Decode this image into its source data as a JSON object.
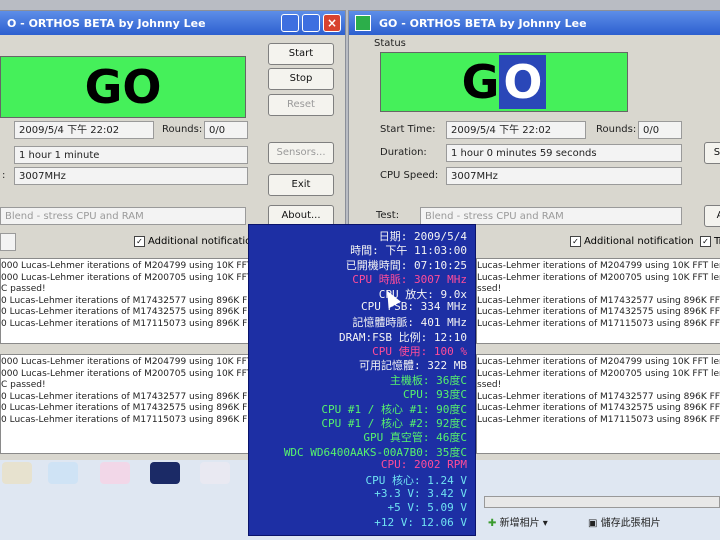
{
  "left_window": {
    "title": "O - ORTHOS BETA by Johnny Lee",
    "go_label": "GO",
    "buttons": {
      "start": "Start",
      "stop": "Stop",
      "reset": "Reset",
      "sensors": "Sensors...",
      "exit": "Exit",
      "about": "About..."
    },
    "start_time": "2009/5/4 下午 22:02",
    "rounds_label": "Rounds:",
    "rounds_value": "0/0",
    "duration": "1 hour 1 minute",
    "cpu_speed": "3007MHz",
    "test_value": "Blend - stress CPU and RAM",
    "additional_notification": "Additional notification",
    "log_top": [
      "000 Lucas-Lehmer iterations of M204799 using 10K FFT length.",
      "000 Lucas-Lehmer iterations of M200705 using 10K FFT length.",
      "C passed!",
      "0 Lucas-Lehmer iterations of M17432577 using 896K FFT length.",
      "0 Lucas-Lehmer iterations of M17432575 using 896K FFT length.",
      "0 Lucas-Lehmer iterations of M17115073 using 896K FFT length."
    ],
    "log_bottom": [
      "000 Lucas-Lehmer iterations of M204799 using 10K FFT length.",
      "000 Lucas-Lehmer iterations of M200705 using 10K FFT length.",
      "C passed!",
      "0 Lucas-Lehmer iterations of M17432577 using 896K FFT length.",
      "0 Lucas-Lehmer iterations of M17432575 using 896K FFT length.",
      "0 Lucas-Lehmer iterations of M17115073 using 896K FFT length."
    ]
  },
  "right_window": {
    "title": "GO - ORTHOS BETA by Johnny Lee",
    "status_label": "Status",
    "go_label_g": "G",
    "go_label_o": "O",
    "start_time_label": "Start Time:",
    "start_time": "2009/5/4 下午 22:02",
    "rounds_label": "Rounds:",
    "rounds_value": "0/0",
    "duration_label": "Duration:",
    "duration": "1 hour 0 minutes 59 seconds",
    "cpu_speed_label": "CPU Speed:",
    "cpu_speed": "3007MHz",
    "test_label": "Test:",
    "test_value": "Blend - stress CPU and RAM",
    "additional_notification": "Additional notification",
    "partial_button": "Se",
    "partial_button2": "A",
    "partial_check": "Tr",
    "log_top": [
      "Lucas-Lehmer iterations of M204799 using 10K FFT length.",
      "Lucas-Lehmer iterations of M200705 using 10K FFT length.",
      "ssed!",
      "Lucas-Lehmer iterations of M17432577 using 896K FFT length.",
      "Lucas-Lehmer iterations of M17432575 using 896K FFT length.",
      "Lucas-Lehmer iterations of M17115073 using 896K FFT length."
    ],
    "log_bottom": [
      "Lucas-Lehmer iterations of M204799 using 10K FFT length.",
      "Lucas-Lehmer iterations of M200705 using 10K FFT length.",
      "ssed!",
      "Lucas-Lehmer iterations of M17432577 using 896K FFT length.",
      "Lucas-Lehmer iterations of M17432575 using 896K FFT length.",
      "Lucas-Lehmer iterations of M17115073 using 896K FFT length."
    ]
  },
  "osd": {
    "date": "日期: 2009/5/4",
    "time": "時間: 下午 11:03:00",
    "uptime": "已開機時間: 07:10:25",
    "cpu_clock": "CPU 時脈: 3007 MHz",
    "cpu_multiplier": "CPU 放大: 9.0x",
    "cpu_fsb": "CPU FSB: 334 MHz",
    "mem_clock": "記憶體時脈: 401 MHz",
    "dram_ratio": "DRAM:FSB 比例: 12:10",
    "cpu_usage": "CPU 使用: 100 %",
    "free_mem": "可用記憶體: 322 MB",
    "mb_temp": "主機板: 36度C",
    "cpu_temp": "CPU: 93度C",
    "core1_temp": "CPU #1 / 核心 #1: 90度C",
    "core2_temp": "CPU #1 / 核心 #2: 92度C",
    "gpu_temp": "GPU 真空管: 46度C",
    "hdd_temp": "WDC WD6400AAKS-00A7B0: 35度C",
    "cpu_fan": "CPU: 2002 RPM",
    "cpu_vcore": "CPU 核心: 1.24 V",
    "v33": "+3.3 V: 3.42 V",
    "v5": "+5 V: 5.09 V",
    "v12": "+12 V: 12.06 V"
  },
  "bottom_bar": {
    "new_photo": "新增相片",
    "save_as": "儲存此張相片"
  },
  "colors": {
    "go_green": "#45f05a",
    "osd_bg": "#1d2fa4",
    "title_blue": "#2d5fcf"
  }
}
